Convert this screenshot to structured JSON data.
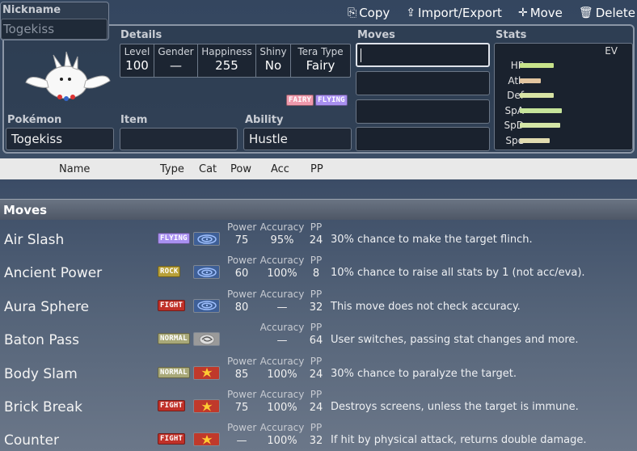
{
  "toolbar": {
    "copy": "Copy",
    "import_export": "Import/Export",
    "move": "Move",
    "delete": "Delete"
  },
  "nickname": {
    "label": "Nickname",
    "placeholder": "Togekiss"
  },
  "details": {
    "label": "Details",
    "level_k": "Level",
    "level_v": "100",
    "gender_k": "Gender",
    "gender_v": "—",
    "happiness_k": "Happiness",
    "happiness_v": "255",
    "shiny_k": "Shiny",
    "shiny_v": "No",
    "tera_k": "Tera Type",
    "tera_v": "Fairy"
  },
  "types": [
    "FAIRY",
    "FLYING"
  ],
  "pokemon": {
    "label": "Pokémon",
    "value": "Togekiss"
  },
  "item": {
    "label": "Item",
    "value": ""
  },
  "ability": {
    "label": "Ability",
    "value": "Hustle"
  },
  "moves_section": {
    "label": "Moves"
  },
  "stats": {
    "label": "Stats",
    "ev_label": "EV",
    "rows": [
      {
        "name": "HP",
        "fraction": 0.49,
        "color": "#c8e38a"
      },
      {
        "name": "Atk",
        "fraction": 0.3,
        "color": "#e3c6a0"
      },
      {
        "name": "Def",
        "fraction": 0.49,
        "color": "#d8e4a4"
      },
      {
        "name": "SpA",
        "fraction": 0.61,
        "color": "#c6e49a"
      },
      {
        "name": "SpD",
        "fraction": 0.59,
        "color": "#d4e6a6"
      },
      {
        "name": "Spe",
        "fraction": 0.43,
        "color": "#e2dcb0"
      }
    ]
  },
  "columns": {
    "name": "Name",
    "type": "Type",
    "cat": "Cat",
    "pow": "Pow",
    "acc": "Acc",
    "pp": "PP"
  },
  "moves_list_title": "Moves",
  "labels": {
    "power": "Power",
    "accuracy": "Accuracy",
    "pp": "PP"
  },
  "moves": [
    {
      "name": "Air Slash",
      "type": "FLYING",
      "cat": "special",
      "power": "75",
      "accuracy": "95%",
      "pp": "24",
      "desc": "30% chance to make the target flinch."
    },
    {
      "name": "Ancient Power",
      "type": "ROCK",
      "cat": "special",
      "power": "60",
      "accuracy": "100%",
      "pp": "8",
      "desc": "10% chance to raise all stats by 1 (not acc/eva)."
    },
    {
      "name": "Aura Sphere",
      "type": "FIGHT",
      "cat": "special",
      "power": "80",
      "accuracy": "—",
      "pp": "32",
      "desc": "This move does not check accuracy."
    },
    {
      "name": "Baton Pass",
      "type": "NORMAL",
      "cat": "status",
      "power": "",
      "accuracy": "—",
      "pp": "64",
      "desc": "User switches, passing stat changes and more."
    },
    {
      "name": "Body Slam",
      "type": "NORMAL",
      "cat": "physical",
      "power": "85",
      "accuracy": "100%",
      "pp": "24",
      "desc": "30% chance to paralyze the target."
    },
    {
      "name": "Brick Break",
      "type": "FIGHT",
      "cat": "physical",
      "power": "75",
      "accuracy": "100%",
      "pp": "24",
      "desc": "Destroys screens, unless the target is immune."
    },
    {
      "name": "Counter",
      "type": "FIGHT",
      "cat": "physical",
      "power": "—",
      "accuracy": "100%",
      "pp": "32",
      "desc": "If hit by physical attack, returns double damage."
    }
  ]
}
